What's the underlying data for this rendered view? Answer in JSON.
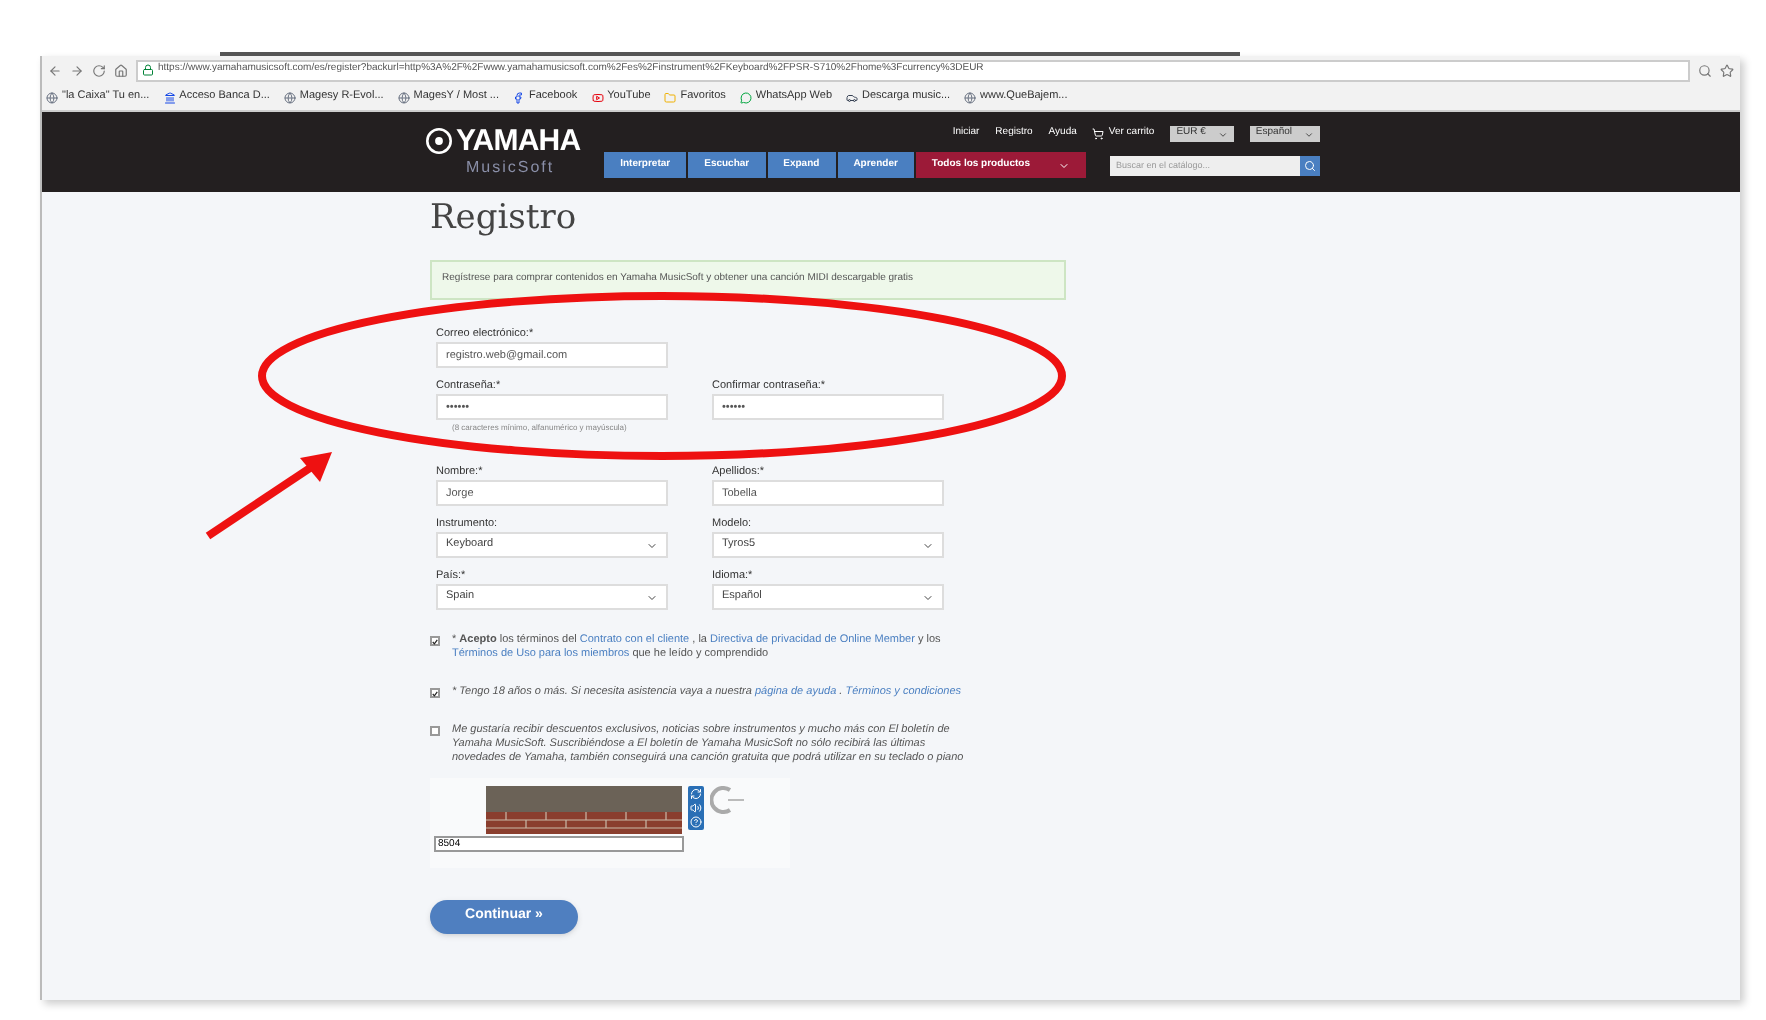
{
  "browser": {
    "url": "https://www.yamahamusicsoft.com/es/register?backurl=http%3A%2F%2Fwww.yamahamusicsoft.com%2Fes%2Finstrument%2FKeyboard%2FPSR-S710%2Fhome%3Fcurrency%3DEUR",
    "bookmarks": [
      {
        "label": "\"la Caixa\" Tu en...",
        "kind": "page"
      },
      {
        "label": "Acceso Banca D...",
        "kind": "bank"
      },
      {
        "label": "Magesy R-Evol...",
        "kind": "page"
      },
      {
        "label": "MagesY / Most ...",
        "kind": "page"
      },
      {
        "label": "Facebook",
        "kind": "facebook"
      },
      {
        "label": "YouTube",
        "kind": "youtube"
      },
      {
        "label": "Favoritos",
        "kind": "folder"
      },
      {
        "label": "WhatsApp Web",
        "kind": "whatsapp"
      },
      {
        "label": "Descarga music...",
        "kind": "car"
      },
      {
        "label": "www.QueBajem...",
        "kind": "page"
      }
    ]
  },
  "header": {
    "brand": "YAMAHA",
    "sub_brand": "MusicSoft",
    "top_links": [
      "Iniciar",
      "Registro",
      "Ayuda",
      "Ver carrito"
    ],
    "currency": "EUR €",
    "language": "Español",
    "nav": [
      {
        "label": "Interpretar",
        "kind": "plain"
      },
      {
        "label": "Escuchar",
        "kind": "plain"
      },
      {
        "label": "Expand",
        "kind": "plain"
      },
      {
        "label": "Aprender",
        "kind": "plain"
      },
      {
        "label": "Todos los productos",
        "kind": "menu"
      }
    ],
    "search": {
      "placeholder": "Buscar en el catálogo..."
    }
  },
  "page": {
    "title": "Registro",
    "notice": "Regístrese para comprar contenidos en Yamaha MusicSoft y obtener una canción MIDI descargable gratis",
    "rows": [
      [
        {
          "label": "Correo electrónico:*",
          "value": "registro.web@gmail.com",
          "kind": "text"
        }
      ],
      [
        {
          "label": "Contraseña:*",
          "value": "••••••",
          "kind": "text",
          "hint": "(8 caracteres mínimo, alfanumérico y mayúscula)"
        },
        {
          "label": "Confirmar contraseña:*",
          "value": "••••••",
          "kind": "text"
        }
      ],
      [
        {
          "label": "Nombre:*",
          "value": "Jorge",
          "kind": "text"
        },
        {
          "label": "Apellidos:*",
          "value": "Tobella",
          "kind": "text"
        }
      ],
      [
        {
          "label": "Instrumento:",
          "value": "Keyboard",
          "kind": "select"
        },
        {
          "label": "Modelo:",
          "value": "Tyros5",
          "kind": "select"
        }
      ],
      [
        {
          "label": "País:*",
          "value": "Spain",
          "kind": "select"
        },
        {
          "label": "Idioma:*",
          "value": "Español",
          "kind": "select"
        }
      ]
    ],
    "consents": [
      {
        "checked": true,
        "italic": false,
        "parts": [
          {
            "kind": "text",
            "text": "* **Acepto** los términos del"
          },
          {
            "kind": "link",
            "text": "Contrato con el cliente"
          },
          {
            "kind": "text",
            "text": ", la"
          },
          {
            "kind": "link",
            "text": "Directiva de privacidad de Online Member"
          },
          {
            "kind": "text",
            "text": "y los"
          },
          {
            "kind": "link",
            "text": "Términos de Uso para los miembros"
          },
          {
            "kind": "text",
            "text": "que he leído y comprendido"
          }
        ]
      },
      {
        "checked": true,
        "italic": true,
        "parts": [
          {
            "kind": "text",
            "text": "* Tengo 18 años o más. Si necesita asistencia vaya a nuestra"
          },
          {
            "kind": "link",
            "text": "página de ayuda"
          },
          {
            "kind": "text",
            "text": "."
          },
          {
            "kind": "link",
            "text": "Términos y condiciones"
          }
        ]
      },
      {
        "checked": false,
        "italic": true,
        "parts": [
          {
            "kind": "text",
            "text": "Me gustaría recibir descuentos exclusivos, noticias sobre instrumentos y mucho más con El boletín de Yamaha MusicSoft. Suscribiéndose a El boletín de Yamaha MusicSoft no sólo recibirá las últimas novedades de Yamaha, también conseguirá una canción gratuita que podrá utilizar en su teclado o piano"
          }
        ]
      }
    ],
    "captcha": {
      "value": "8504"
    },
    "submit": "Continuar »"
  }
}
